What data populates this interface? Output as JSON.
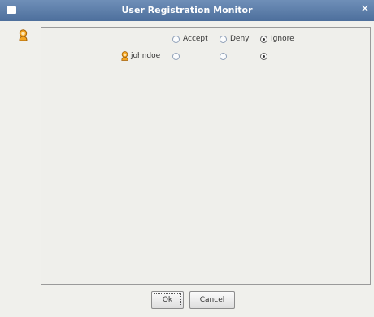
{
  "window": {
    "title": "User Registration Monitor",
    "menu_icon": "window-menu-icon",
    "close_icon": "close-icon"
  },
  "left_icon": "user-icon",
  "options": {
    "accept_label": "Accept",
    "deny_label": "Deny",
    "ignore_label": "Ignore",
    "header_selected": "ignore"
  },
  "users": [
    {
      "name": "johndoe",
      "icon": "user-icon",
      "selected": "ignore"
    }
  ],
  "buttons": {
    "ok_label": "Ok",
    "cancel_label": "Cancel"
  },
  "colors": {
    "titlebar": "#5b7eaa",
    "background": "#f0f0ec",
    "icon_orange": "#f0a020"
  }
}
